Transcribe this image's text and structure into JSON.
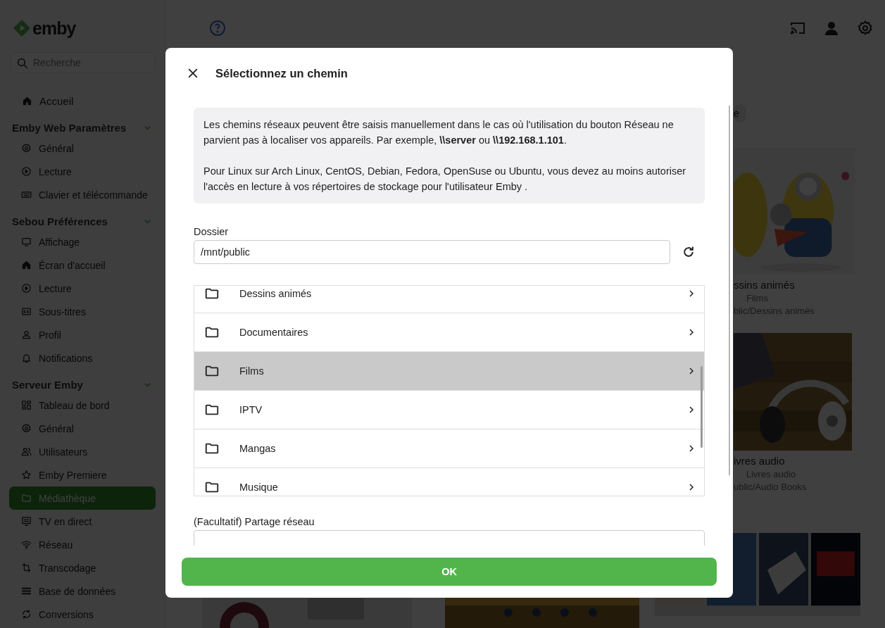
{
  "sidebar": {
    "logo": "emby",
    "search": {
      "placeholder": "Recherche"
    },
    "home": {
      "label": "Accueil",
      "selected": false
    },
    "sections": [
      {
        "title": "Emby Web Paramètres",
        "expanded": true,
        "items": [
          {
            "label": "Général",
            "selected": false
          },
          {
            "label": "Lecture",
            "selected": false
          },
          {
            "label": "Clavier et télécommande",
            "selected": false
          }
        ]
      },
      {
        "title": "Sebou Préférences",
        "expanded": true,
        "items": [
          {
            "label": "Affichage",
            "selected": false
          },
          {
            "label": "Écran d'accueil",
            "selected": false
          },
          {
            "label": "Lecture",
            "selected": false
          },
          {
            "label": "Sous-titres",
            "selected": false
          },
          {
            "label": "Profil",
            "selected": false
          },
          {
            "label": "Notifications",
            "selected": false
          }
        ]
      },
      {
        "title": "Serveur Emby",
        "expanded": true,
        "items": [
          {
            "label": "Tableau de bord",
            "selected": false
          },
          {
            "label": "Général",
            "selected": false
          },
          {
            "label": "Utilisateurs",
            "selected": false
          },
          {
            "label": "Emby Premiere",
            "selected": false
          },
          {
            "label": "Médiathèque",
            "selected": true
          },
          {
            "label": "TV en direct",
            "selected": false
          },
          {
            "label": "Réseau",
            "selected": false
          },
          {
            "label": "Transcodage",
            "selected": false
          },
          {
            "label": "Base de données",
            "selected": false
          },
          {
            "label": "Conversions",
            "selected": false
          }
        ]
      }
    ]
  },
  "main": {
    "chip": "e",
    "cards": [
      {
        "title": "ssins animés",
        "subtitle": "Films",
        "path": "blic/Dessins animés"
      },
      {
        "title": "ivres audio",
        "subtitle": "Livres audio",
        "path": "ublic/Audio Books"
      }
    ]
  },
  "dialog": {
    "title": "Sélectionnez un chemin",
    "info": [
      "Les chemins réseaux peuvent être saisis manuellement dans le cas où l'utilisation du bouton Réseau ne parvient pas à localiser vos appareils. Par exemple, **\\\\server** ou **\\\\192.168.1.101**.",
      "Pour Linux sur Arch Linux, CentOS, Debian, Fedora, OpenSuse ou Ubuntu, vous devez au moins autoriser l'accès en lecture à vos répertoires de stockage pour l'utilisateur Emby ."
    ],
    "folder_field": {
      "label": "Dossier",
      "value": "/mnt/public"
    },
    "folders": [
      {
        "name": "Dessins animés",
        "selected": false
      },
      {
        "name": "Documentaires",
        "selected": false
      },
      {
        "name": "Films",
        "selected": true
      },
      {
        "name": "IPTV",
        "selected": false
      },
      {
        "name": "Mangas",
        "selected": false
      },
      {
        "name": "Musique",
        "selected": false
      }
    ],
    "share_field": {
      "label": "(Facultatif) Partage réseau"
    },
    "ok_button": "OK"
  }
}
